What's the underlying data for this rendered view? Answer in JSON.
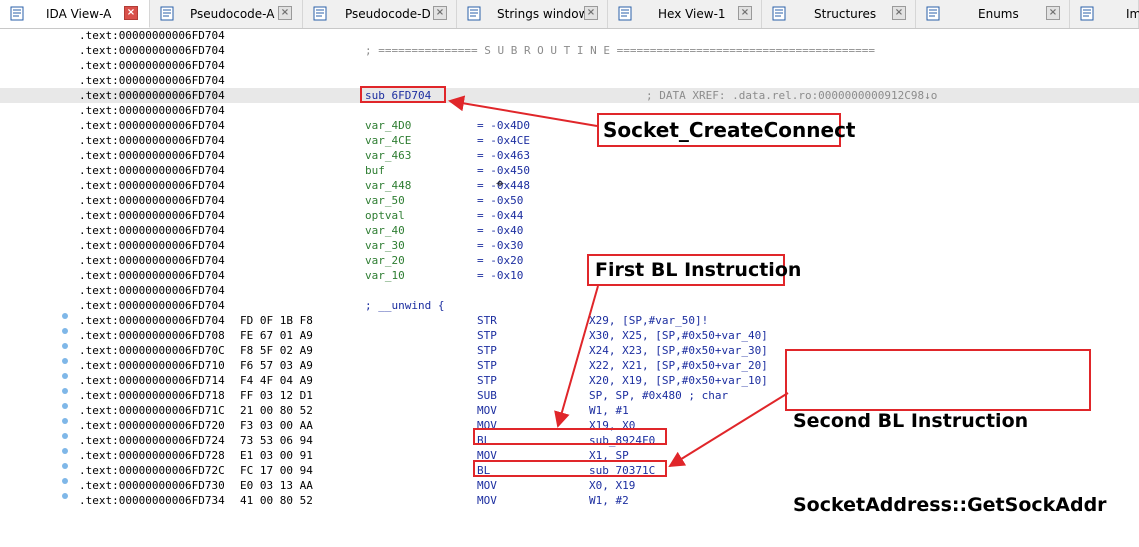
{
  "tabs": [
    {
      "label": "IDA View-A",
      "active": true,
      "icon": "listing-icon"
    },
    {
      "label": "Pseudocode-A",
      "active": false,
      "icon": "pseudocode-icon"
    },
    {
      "label": "Pseudocode-D",
      "active": false,
      "icon": "pseudocode-icon"
    },
    {
      "label": "Strings window",
      "active": false,
      "icon": "strings-icon"
    },
    {
      "label": "Hex View-1",
      "active": false,
      "icon": "hex-icon"
    },
    {
      "label": "Structures",
      "active": false,
      "icon": "structures-icon"
    },
    {
      "label": "Enums",
      "active": false,
      "icon": "enums-icon"
    },
    {
      "label": "Im",
      "active": false,
      "icon": "imports-icon"
    }
  ],
  "close_glyph": "×",
  "rows": [
    {
      "addr": ".text:00000000006FD704",
      "bytes": "",
      "c1": "",
      "c2": "",
      "c3": "",
      "dot": false
    },
    {
      "addr": ".text:00000000006FD704",
      "bytes": "",
      "c1": "; =============== S U B R O U T I N E =======================================",
      "c2": "",
      "c3": "",
      "dot": false,
      "kind": "sep"
    },
    {
      "addr": ".text:00000000006FD704",
      "bytes": "",
      "c1": "",
      "c2": "",
      "c3": "",
      "dot": false
    },
    {
      "addr": ".text:00000000006FD704",
      "bytes": "",
      "c1": "",
      "c2": "",
      "c3": "",
      "dot": false
    },
    {
      "addr": ".text:00000000006FD704",
      "bytes": "",
      "c1": "sub_6FD704",
      "c2": "",
      "c3": "",
      "cmt": "; DATA XREF: .data.rel.ro:0000000000912C98↓o",
      "dot": false,
      "highlight": true
    },
    {
      "addr": ".text:00000000006FD704",
      "bytes": "",
      "c1": "",
      "c2": "",
      "c3": "",
      "dot": false
    },
    {
      "addr": ".text:00000000006FD704",
      "bytes": "",
      "c1": "var_4D0",
      "c2": "= -0x4D0",
      "c3": "",
      "dot": false,
      "kind": "var"
    },
    {
      "addr": ".text:00000000006FD704",
      "bytes": "",
      "c1": "var_4CE",
      "c2": "= -0x4CE",
      "c3": "",
      "dot": false,
      "kind": "var"
    },
    {
      "addr": ".text:00000000006FD704",
      "bytes": "",
      "c1": "var_463",
      "c2": "= -0x463",
      "c3": "",
      "dot": false,
      "kind": "var"
    },
    {
      "addr": ".text:00000000006FD704",
      "bytes": "",
      "c1": "buf",
      "c2": "= -0x450",
      "c3": "",
      "dot": false,
      "kind": "var"
    },
    {
      "addr": ".text:00000000006FD704",
      "bytes": "",
      "c1": "var_448",
      "c2": "= -0x448",
      "c3": "",
      "dot": false,
      "kind": "var"
    },
    {
      "addr": ".text:00000000006FD704",
      "bytes": "",
      "c1": "var_50",
      "c2": "= -0x50",
      "c3": "",
      "dot": false,
      "kind": "var"
    },
    {
      "addr": ".text:00000000006FD704",
      "bytes": "",
      "c1": "optval",
      "c2": "= -0x44",
      "c3": "",
      "dot": false,
      "kind": "var"
    },
    {
      "addr": ".text:00000000006FD704",
      "bytes": "",
      "c1": "var_40",
      "c2": "= -0x40",
      "c3": "",
      "dot": false,
      "kind": "var"
    },
    {
      "addr": ".text:00000000006FD704",
      "bytes": "",
      "c1": "var_30",
      "c2": "= -0x30",
      "c3": "",
      "dot": false,
      "kind": "var"
    },
    {
      "addr": ".text:00000000006FD704",
      "bytes": "",
      "c1": "var_20",
      "c2": "= -0x20",
      "c3": "",
      "dot": false,
      "kind": "var"
    },
    {
      "addr": ".text:00000000006FD704",
      "bytes": "",
      "c1": "var_10",
      "c2": "= -0x10",
      "c3": "",
      "dot": false,
      "kind": "var"
    },
    {
      "addr": ".text:00000000006FD704",
      "bytes": "",
      "c1": "",
      "c2": "",
      "c3": "",
      "dot": false
    },
    {
      "addr": ".text:00000000006FD704",
      "bytes": "",
      "c1": "; __unwind {",
      "c2": "",
      "c3": "",
      "dot": false,
      "kind": "unwind"
    },
    {
      "addr": ".text:00000000006FD704",
      "bytes": "FD 0F 1B F8",
      "c1": "",
      "c2": "STR",
      "c3": "X29, [SP,#var_50]!",
      "dot": true,
      "kind": "ins"
    },
    {
      "addr": ".text:00000000006FD708",
      "bytes": "FE 67 01 A9",
      "c1": "",
      "c2": "STP",
      "c3": "X30, X25, [SP,#0x50+var_40]",
      "dot": true,
      "kind": "ins"
    },
    {
      "addr": ".text:00000000006FD70C",
      "bytes": "F8 5F 02 A9",
      "c1": "",
      "c2": "STP",
      "c3": "X24, X23, [SP,#0x50+var_30]",
      "dot": true,
      "kind": "ins"
    },
    {
      "addr": ".text:00000000006FD710",
      "bytes": "F6 57 03 A9",
      "c1": "",
      "c2": "STP",
      "c3": "X22, X21, [SP,#0x50+var_20]",
      "dot": true,
      "kind": "ins"
    },
    {
      "addr": ".text:00000000006FD714",
      "bytes": "F4 4F 04 A9",
      "c1": "",
      "c2": "STP",
      "c3": "X20, X19, [SP,#0x50+var_10]",
      "dot": true,
      "kind": "ins"
    },
    {
      "addr": ".text:00000000006FD718",
      "bytes": "FF 03 12 D1",
      "c1": "",
      "c2": "SUB",
      "c3": "SP, SP, #0x480 ; char",
      "dot": true,
      "kind": "ins"
    },
    {
      "addr": ".text:00000000006FD71C",
      "bytes": "21 00 80 52",
      "c1": "",
      "c2": "MOV",
      "c3": "W1, #1",
      "dot": true,
      "kind": "ins"
    },
    {
      "addr": ".text:00000000006FD720",
      "bytes": "F3 03 00 AA",
      "c1": "",
      "c2": "MOV",
      "c3": "X19, X0",
      "dot": true,
      "kind": "ins"
    },
    {
      "addr": ".text:00000000006FD724",
      "bytes": "73 53 06 94",
      "c1": "",
      "c2": "BL",
      "c3": "sub_8924F0",
      "dot": true,
      "kind": "ins"
    },
    {
      "addr": ".text:00000000006FD728",
      "bytes": "E1 03 00 91",
      "c1": "",
      "c2": "MOV",
      "c3": "X1, SP",
      "dot": true,
      "kind": "ins"
    },
    {
      "addr": ".text:00000000006FD72C",
      "bytes": "FC 17 00 94",
      "c1": "",
      "c2": "BL",
      "c3": "sub_70371C",
      "dot": true,
      "kind": "ins"
    },
    {
      "addr": ".text:00000000006FD730",
      "bytes": "E0 03 13 AA",
      "c1": "",
      "c2": "MOV",
      "c3": "X0, X19",
      "dot": true,
      "kind": "ins"
    },
    {
      "addr": ".text:00000000006FD734",
      "bytes": "41 00 80 52",
      "c1": "",
      "c2": "MOV",
      "c3": "W1, #2",
      "dot": true,
      "kind": "ins"
    }
  ],
  "annotations": {
    "socket_label": "Socket_CreateConnect",
    "first_bl_label": "First BL Instruction",
    "second_bl_label_1": "Second BL Instruction",
    "second_bl_label_2": "SocketAddress::GetSockAddr"
  },
  "colors": {
    "annotation": "#e0262a",
    "highlight_row": "#e8e8e8",
    "variable": "#2e7d32",
    "operand": "#1c2ea0"
  }
}
